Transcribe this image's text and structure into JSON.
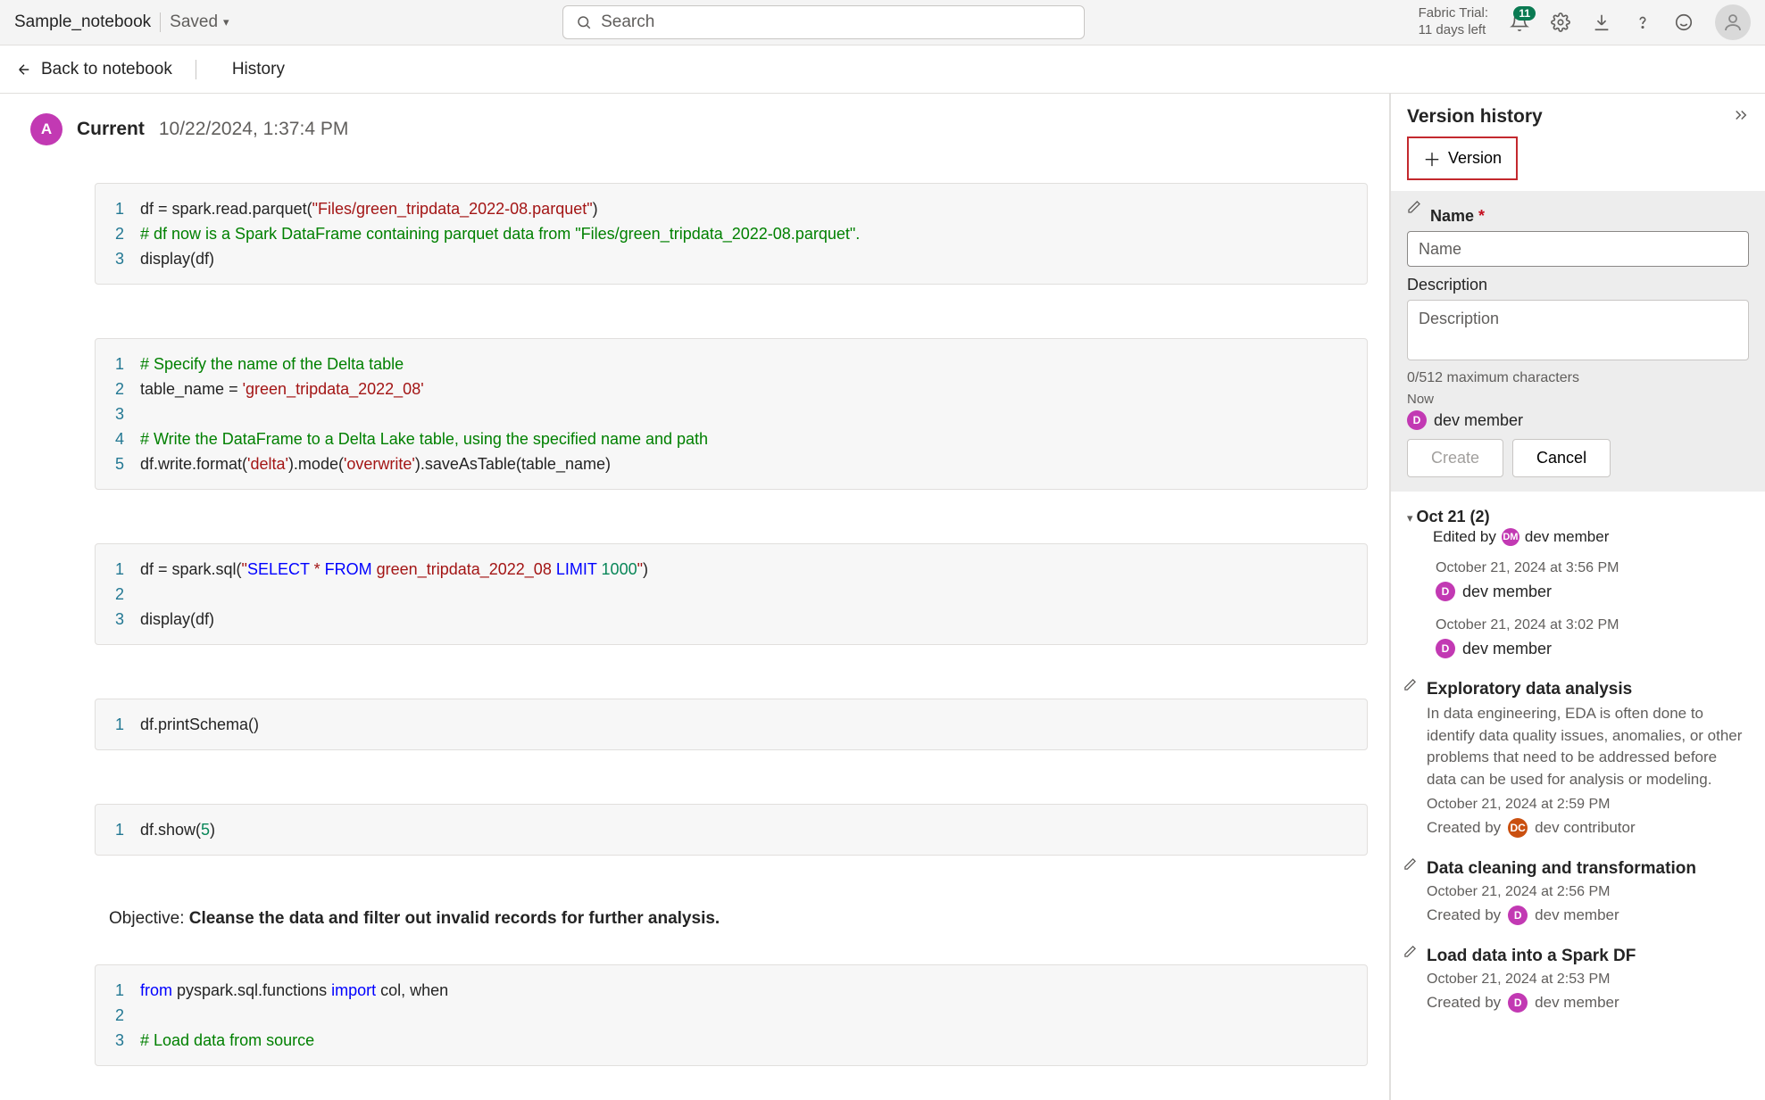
{
  "topbar": {
    "notebook_name": "Sample_notebook",
    "saved_label": "Saved",
    "search_placeholder": "Search",
    "trial_line1": "Fabric Trial:",
    "trial_line2": "11 days left",
    "notif_count": "11"
  },
  "secondbar": {
    "back_label": "Back to notebook",
    "history_label": "History"
  },
  "current": {
    "avatar_letter": "A",
    "label": "Current",
    "timestamp": "10/22/2024, 1:37:4 PM"
  },
  "cells": [
    {
      "lines": [
        {
          "n": "1",
          "segs": [
            {
              "t": "df = spark.read.parquet("
            },
            {
              "t": "\"Files/green_tripdata_2022-08.parquet\"",
              "c": "str"
            },
            {
              "t": ")"
            }
          ]
        },
        {
          "n": "2",
          "segs": [
            {
              "t": "# df now is a Spark DataFrame containing parquet data from \"Files/green_tripdata_2022-08.parquet\".",
              "c": "cmt"
            }
          ]
        },
        {
          "n": "3",
          "segs": [
            {
              "t": "display(df)"
            }
          ]
        }
      ],
      "first": true
    },
    {
      "lines": [
        {
          "n": "1",
          "segs": [
            {
              "t": "# Specify the name of the Delta table",
              "c": "cmt"
            }
          ]
        },
        {
          "n": "2",
          "segs": [
            {
              "t": "table_name = "
            },
            {
              "t": "'green_tripdata_2022_08'",
              "c": "str"
            }
          ]
        },
        {
          "n": "3",
          "segs": [
            {
              "t": ""
            }
          ]
        },
        {
          "n": "4",
          "segs": [
            {
              "t": "# Write the DataFrame to a Delta Lake table, using the specified name and path",
              "c": "cmt"
            }
          ]
        },
        {
          "n": "5",
          "segs": [
            {
              "t": "df.write.format("
            },
            {
              "t": "'delta'",
              "c": "str"
            },
            {
              "t": ").mode("
            },
            {
              "t": "'overwrite'",
              "c": "str"
            },
            {
              "t": ").saveAsTable(table_name)"
            }
          ]
        }
      ]
    },
    {
      "lines": [
        {
          "n": "1",
          "segs": [
            {
              "t": "df = spark.sql("
            },
            {
              "t": "\"",
              "c": "str"
            },
            {
              "t": "SELECT",
              "c": "sqlkw"
            },
            {
              "t": " * ",
              "c": "str"
            },
            {
              "t": "FROM",
              "c": "sqlkw"
            },
            {
              "t": " green_tripdata_2022_08 ",
              "c": "str"
            },
            {
              "t": "LIMIT",
              "c": "sqlkw"
            },
            {
              "t": " ",
              "c": "str"
            },
            {
              "t": "1000",
              "c": "num"
            },
            {
              "t": "\"",
              "c": "str"
            },
            {
              "t": ")"
            }
          ]
        },
        {
          "n": "2",
          "segs": [
            {
              "t": ""
            }
          ]
        },
        {
          "n": "3",
          "segs": [
            {
              "t": "display(df)"
            }
          ]
        }
      ]
    },
    {
      "lines": [
        {
          "n": "1",
          "segs": [
            {
              "t": "df.printSchema()"
            }
          ]
        }
      ]
    },
    {
      "lines": [
        {
          "n": "1",
          "segs": [
            {
              "t": "df.show("
            },
            {
              "t": "5",
              "c": "num"
            },
            {
              "t": ")"
            }
          ]
        }
      ]
    }
  ],
  "objective": {
    "label": "Objective: ",
    "text": "Cleanse the data and filter out invalid records for further analysis."
  },
  "cell_last": {
    "lines": [
      {
        "n": "1",
        "segs": [
          {
            "t": "from ",
            "c": "kw"
          },
          {
            "t": "pyspark.sql.functions "
          },
          {
            "t": "import ",
            "c": "kw"
          },
          {
            "t": "col, when"
          }
        ]
      },
      {
        "n": "2",
        "segs": [
          {
            "t": ""
          }
        ]
      },
      {
        "n": "3",
        "segs": [
          {
            "t": "# Load data from source",
            "c": "cmt"
          }
        ]
      }
    ]
  },
  "rpanel": {
    "title": "Version history",
    "version_btn": "Version",
    "name_label": "Name",
    "name_placeholder": "Name",
    "desc_label": "Description",
    "desc_placeholder": "Description",
    "char_count": "0/512 maximum characters",
    "now_label": "Now",
    "now_user": "dev member",
    "create_btn": "Create",
    "cancel_btn": "Cancel",
    "group_title": "Oct 21 (2)",
    "group_edited": "Edited by",
    "group_editor": "dev member",
    "entries": [
      {
        "ts": "October 21, 2024 at 3:56 PM",
        "user": "dev member"
      },
      {
        "ts": "October 21, 2024 at 3:02 PM",
        "user": "dev member"
      }
    ],
    "named": [
      {
        "title": "Exploratory data analysis",
        "desc": "In data engineering, EDA is often done to identify data quality issues, anomalies, or other problems that need to be addressed before data can be used for analysis or modeling.",
        "ts": "October 21, 2024 at 2:59 PM",
        "by_label": "Created by",
        "by": "dev contributor",
        "pill": "DC",
        "pillClass": "pill-dc"
      },
      {
        "title": "Data cleaning and transformation",
        "desc": "",
        "ts": "October 21, 2024 at 2:56 PM",
        "by_label": "Created by",
        "by": "dev member",
        "pill": "D",
        "pillClass": "pill-d"
      },
      {
        "title": "Load data into a Spark DF",
        "desc": "",
        "ts": "October 21, 2024 at 2:53 PM",
        "by_label": "Created by",
        "by": "dev member",
        "pill": "D",
        "pillClass": "pill-d"
      }
    ]
  }
}
